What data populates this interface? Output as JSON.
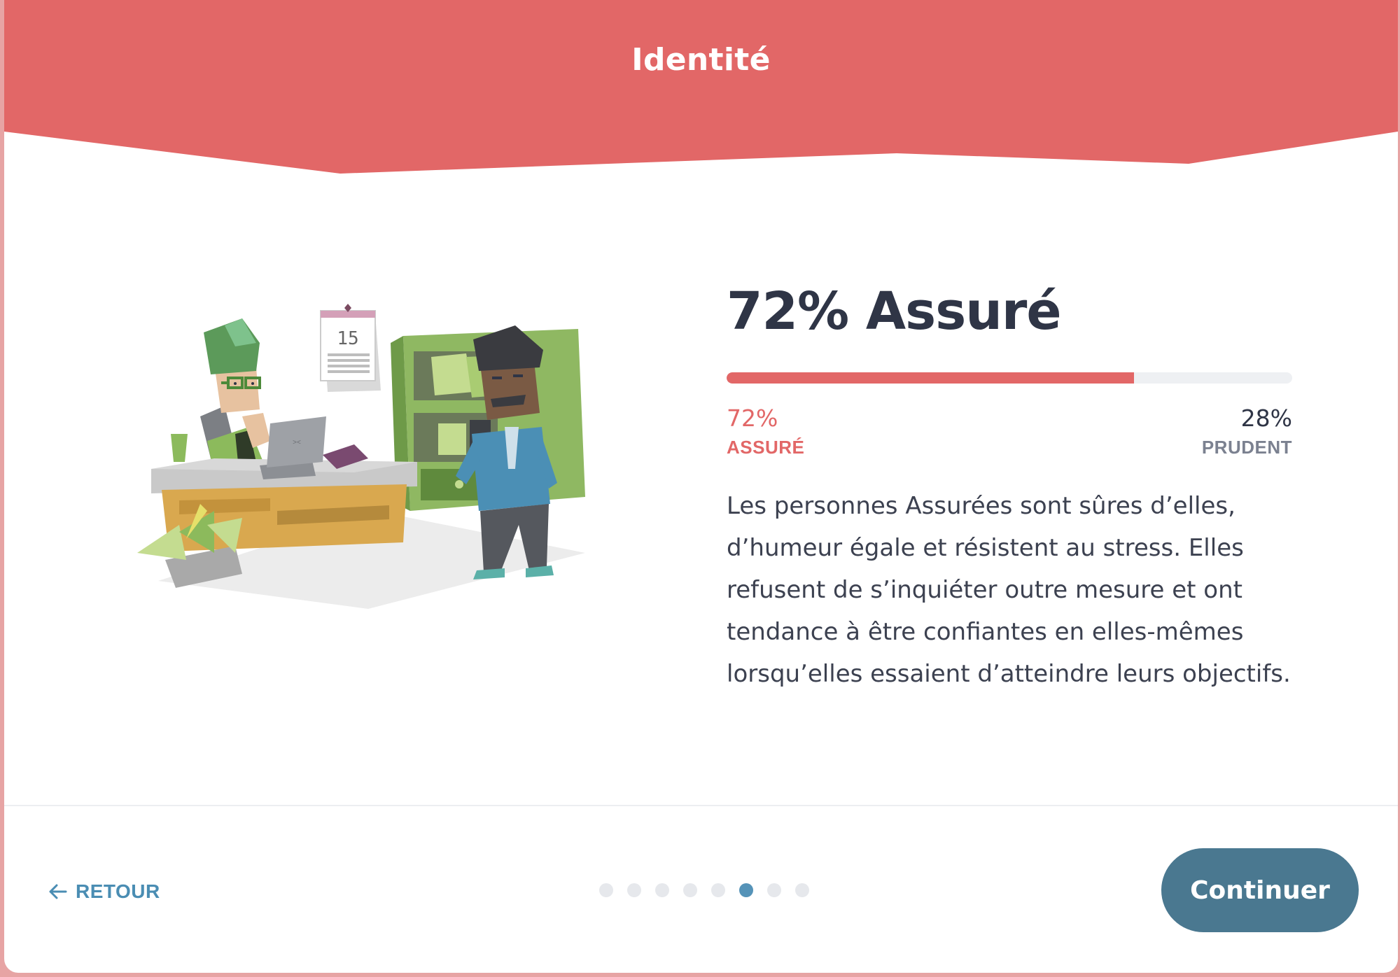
{
  "header": {
    "title": "Identité",
    "color": "#e26767"
  },
  "result": {
    "title": "72% Assuré",
    "progress": 0.72,
    "left": {
      "percent": "72%",
      "label": "ASSURÉ"
    },
    "right": {
      "percent": "28%",
      "label": "PRUDENT"
    },
    "description": "Les personnes Assurées sont sûres d’elles, d’humeur égale et résistent au stress. Elles refusent de s’inquiéter outre mesure et ont tendance à être confiantes en elles-mêmes lorsqu’elles essaient d’atteindre leurs objectifs."
  },
  "illustration": {
    "calendar_day": "15"
  },
  "footer": {
    "back_label": "RETOUR",
    "back_icon": "arrow-left-icon",
    "pagination": {
      "total": 8,
      "current": 6
    },
    "continue_label": "Continuer"
  },
  "colors": {
    "accent": "#e26767",
    "link": "#4a8db3",
    "button": "#4a7890",
    "dot_active": "#5593b8",
    "text_dark": "#2f3546"
  }
}
